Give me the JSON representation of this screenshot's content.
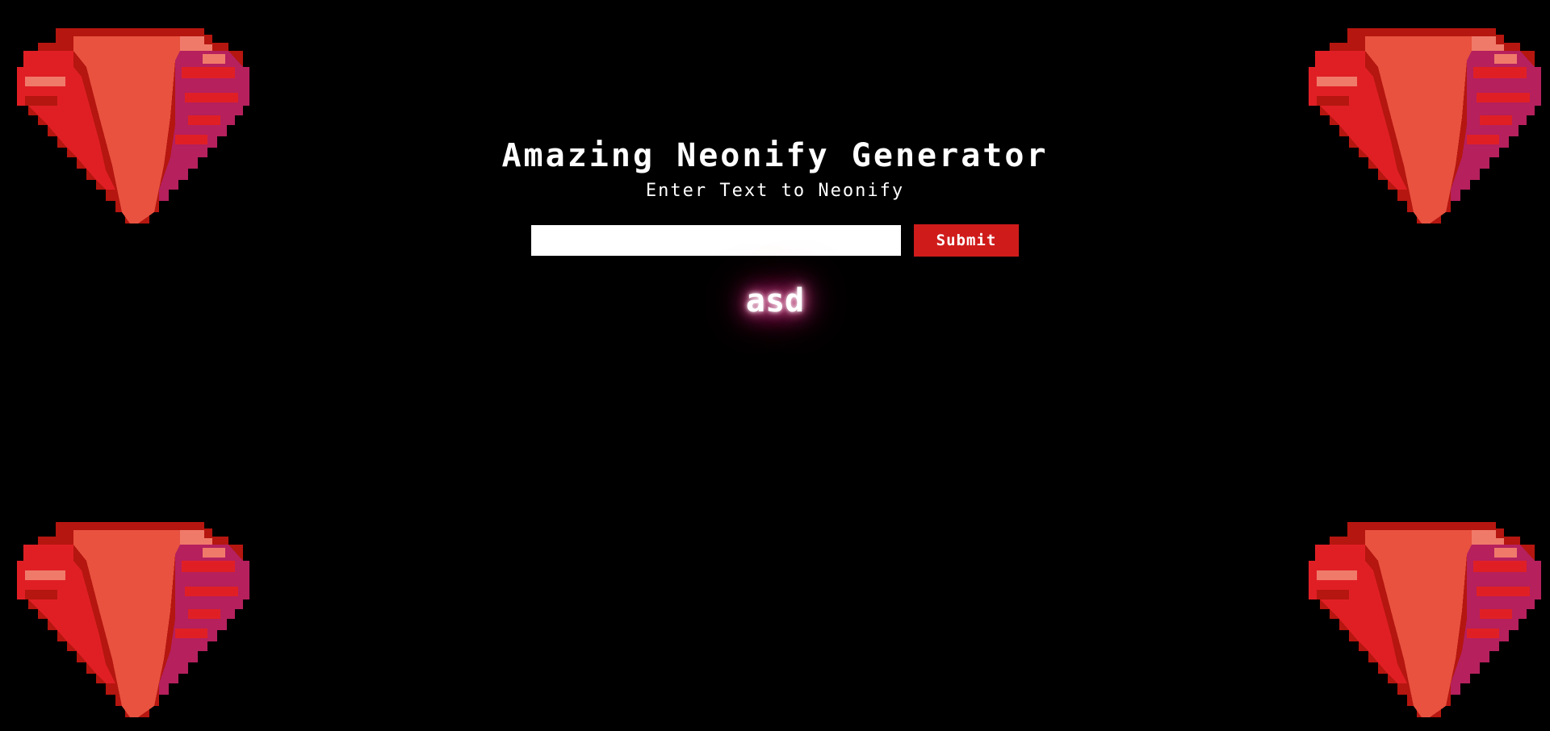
{
  "header": {
    "title": "Amazing Neonify Generator",
    "subtitle": "Enter Text to Neonify"
  },
  "form": {
    "input_value": "",
    "input_placeholder": "",
    "submit_label": "Submit"
  },
  "output": {
    "text": "asd"
  },
  "decorations": {
    "gem_icon_name": "ruby-gem-icon",
    "colors": {
      "background": "#000000",
      "button": "#d01b1b",
      "neon_glow": "#ff2a8a",
      "gem_light": "#e8523f",
      "gem_mid": "#e01f25",
      "gem_dark": "#b5160f",
      "gem_accent": "#b5205d",
      "gem_highlight": "#f07a6a"
    }
  }
}
